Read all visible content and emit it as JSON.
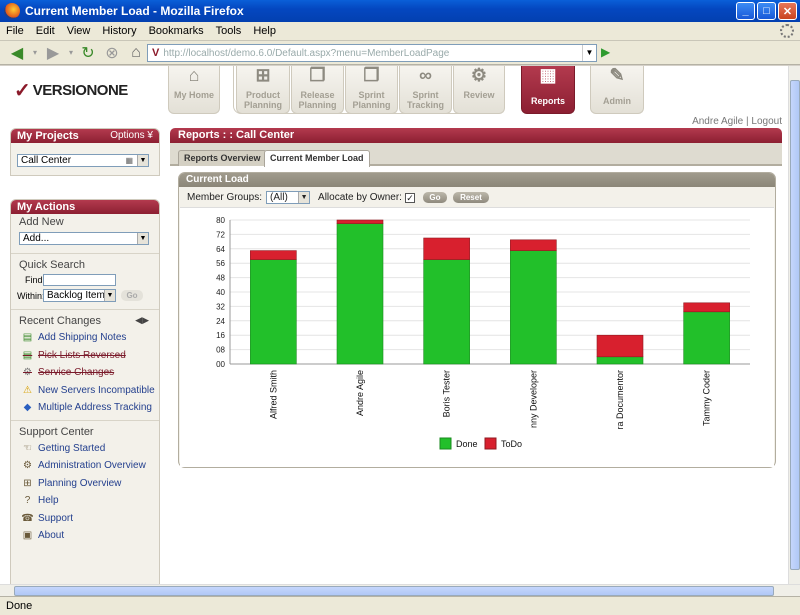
{
  "window": {
    "title": "Current Member Load - Mozilla Firefox"
  },
  "menu": [
    "File",
    "Edit",
    "View",
    "History",
    "Bookmarks",
    "Tools",
    "Help"
  ],
  "browser": {
    "url": "http://localhost/demo.6.0/Default.aspx?menu=MemberLoadPage",
    "status": "Done"
  },
  "logo": {
    "text": "VERSIONONE"
  },
  "nav_tabs": [
    {
      "label": "My Home",
      "icon": "home-icon",
      "glyph": "⌂"
    },
    {
      "label": "Product Planning",
      "icon": "hierarchy-icon",
      "glyph": "⊞"
    },
    {
      "label": "Release Planning",
      "icon": "docs-icon",
      "glyph": "❐"
    },
    {
      "label": "Sprint Planning",
      "icon": "pages-icon",
      "glyph": "❒"
    },
    {
      "label": "Sprint Tracking",
      "icon": "binoculars-icon",
      "glyph": "∞"
    },
    {
      "label": "Review",
      "icon": "gear-icon",
      "glyph": "⚙"
    },
    {
      "label": "Reports",
      "icon": "chart-icon",
      "glyph": "▦"
    },
    {
      "label": "Admin",
      "icon": "wrench-icon",
      "glyph": "✎"
    }
  ],
  "user": {
    "name": "Andre Agile",
    "separator": "|",
    "logout": "Logout"
  },
  "sidebar": {
    "projects": {
      "title": "My Projects",
      "options": "Options ¥",
      "selected": "Call Center"
    },
    "actions": {
      "title": "My Actions",
      "add_new": "Add New",
      "add_placeholder": "Add..."
    },
    "quick_search": {
      "title": "Quick Search",
      "find_label": "Find:",
      "within_label": "Within:",
      "within_value": "Backlog Items",
      "go": "Go"
    },
    "recent_changes": {
      "title": "Recent Changes",
      "items": [
        {
          "label": "Add Shipping Notes",
          "icon": "story-icon",
          "glyph": "▤",
          "color": "#3a8a2a",
          "struck": false
        },
        {
          "label": "Pick Lists Reversed",
          "icon": "story-icon",
          "glyph": "▤",
          "color": "#3a8a2a",
          "struck": true
        },
        {
          "label": "Service Changes",
          "icon": "gear-icon",
          "glyph": "⚙",
          "color": "#777777",
          "struck": true
        },
        {
          "label": "New Servers Incompatible",
          "icon": "warning-icon",
          "glyph": "⚠",
          "color": "#d8a000",
          "struck": false
        },
        {
          "label": "Multiple Address Tracking",
          "icon": "defect-icon",
          "glyph": "◆",
          "color": "#2a5fc0",
          "struck": false
        }
      ]
    },
    "support": {
      "title": "Support Center",
      "items": [
        {
          "label": "Getting Started",
          "icon": "hands-icon",
          "glyph": "☜"
        },
        {
          "label": "Administration Overview",
          "icon": "gear-icon",
          "glyph": "⚙"
        },
        {
          "label": "Planning Overview",
          "icon": "hierarchy-icon",
          "glyph": "⊞"
        },
        {
          "label": "Help",
          "icon": "help-icon",
          "glyph": "?"
        },
        {
          "label": "Support",
          "icon": "phone-icon",
          "glyph": "☎"
        },
        {
          "label": "About",
          "icon": "info-icon",
          "glyph": "▣"
        }
      ]
    }
  },
  "main": {
    "header": "Reports : : Call Center",
    "tabs": [
      "Reports Overview",
      "Current Member Load"
    ],
    "load": {
      "title": "Current Load",
      "member_groups_label": "Member Groups:",
      "member_groups_value": "(All)",
      "allocate_label": "Allocate by Owner:",
      "allocate_checked": "✓",
      "go": "Go",
      "reset": "Reset"
    }
  },
  "colors": {
    "done": "#22c02a",
    "todo": "#d8202e",
    "accent": "#8c1f32"
  },
  "chart_data": {
    "type": "bar",
    "stacked": true,
    "categories": [
      "Alfred Smith",
      "Andre Agile",
      "Boris Tester",
      "nny Developer",
      "ra Documentor",
      "Tammy Coder"
    ],
    "series": [
      {
        "name": "Done",
        "values": [
          58,
          78,
          58,
          63,
          4,
          29
        ]
      },
      {
        "name": "ToDo",
        "values": [
          5,
          2,
          12,
          6,
          12,
          5
        ]
      }
    ],
    "ylim": [
      0,
      80
    ],
    "yticks": [
      "80",
      "72",
      "64",
      "56",
      "48",
      "40",
      "32",
      "24",
      "16",
      "08",
      "00"
    ],
    "legend_position": "bottom",
    "grid": true
  }
}
